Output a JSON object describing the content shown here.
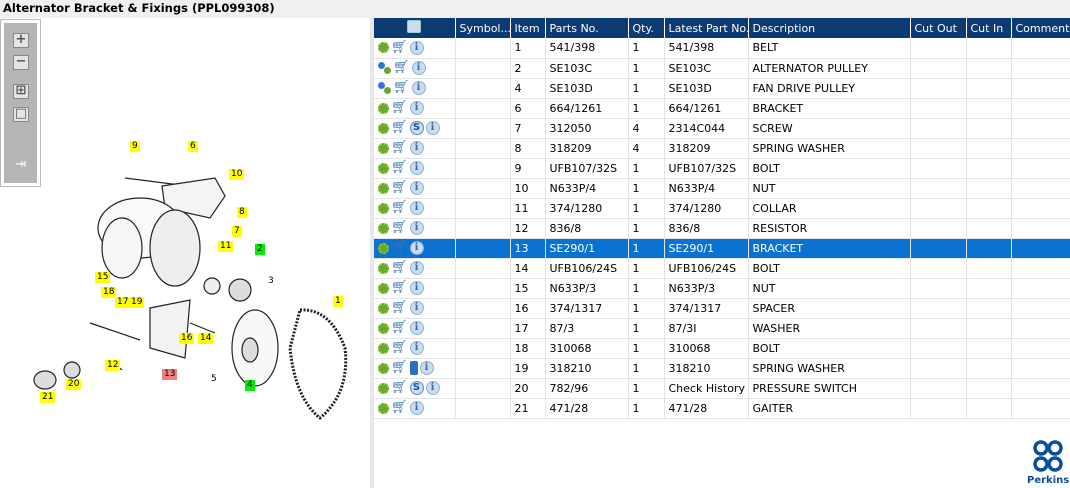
{
  "title": "Alternator Bracket & Fixings (PPL099308)",
  "toolbar": [
    "zoom-in",
    "zoom-out",
    "fit-all",
    "fit-window",
    "export"
  ],
  "callouts": [
    "9",
    "6",
    "10",
    "8",
    "7",
    "11",
    "2",
    "3",
    "15",
    "18",
    "17",
    "19",
    "1",
    "16",
    "14",
    "12",
    "13",
    "5",
    "4",
    "20",
    "21"
  ],
  "columns": [
    "",
    "Symbol...",
    "Item",
    "Parts No.",
    "Qty.",
    "Latest Part No.",
    "Description",
    "Cut Out",
    "Cut In",
    "Comment"
  ],
  "rows": [
    {
      "gear": "green",
      "extra": "",
      "item": "1",
      "part": "541/398",
      "qty": "1",
      "latest": "541/398",
      "desc": "BELT"
    },
    {
      "gear": "multi",
      "extra": "",
      "item": "2",
      "part": "SE103C",
      "qty": "1",
      "latest": "SE103C",
      "desc": "ALTERNATOR PULLEY"
    },
    {
      "gear": "multi",
      "extra": "",
      "item": "4",
      "part": "SE103D",
      "qty": "1",
      "latest": "SE103D",
      "desc": "FAN DRIVE PULLEY"
    },
    {
      "gear": "green",
      "extra": "",
      "item": "6",
      "part": "664/1261",
      "qty": "1",
      "latest": "664/1261",
      "desc": "BRACKET"
    },
    {
      "gear": "green",
      "extra": "S",
      "item": "7",
      "part": "312050",
      "qty": "4",
      "latest": "2314C044",
      "desc": "SCREW"
    },
    {
      "gear": "green",
      "extra": "",
      "item": "8",
      "part": "318209",
      "qty": "4",
      "latest": "318209",
      "desc": "SPRING WASHER"
    },
    {
      "gear": "green",
      "extra": "",
      "item": "9",
      "part": "UFB107/32S",
      "qty": "1",
      "latest": "UFB107/32S",
      "desc": "BOLT"
    },
    {
      "gear": "green",
      "extra": "",
      "item": "10",
      "part": "N633P/4",
      "qty": "1",
      "latest": "N633P/4",
      "desc": "NUT"
    },
    {
      "gear": "green",
      "extra": "",
      "item": "11",
      "part": "374/1280",
      "qty": "1",
      "latest": "374/1280",
      "desc": "COLLAR"
    },
    {
      "gear": "green",
      "extra": "",
      "item": "12",
      "part": "836/8",
      "qty": "1",
      "latest": "836/8",
      "desc": "RESISTOR"
    },
    {
      "gear": "green",
      "extra": "",
      "item": "13",
      "part": "SE290/1",
      "qty": "1",
      "latest": "SE290/1",
      "desc": "BRACKET",
      "selected": true
    },
    {
      "gear": "green",
      "extra": "",
      "item": "14",
      "part": "UFB106/24S",
      "qty": "1",
      "latest": "UFB106/24S",
      "desc": "BOLT"
    },
    {
      "gear": "green",
      "extra": "",
      "item": "15",
      "part": "N633P/3",
      "qty": "1",
      "latest": "N633P/3",
      "desc": "NUT"
    },
    {
      "gear": "green",
      "extra": "",
      "item": "16",
      "part": "374/1317",
      "qty": "1",
      "latest": "374/1317",
      "desc": "SPACER"
    },
    {
      "gear": "green",
      "extra": "",
      "item": "17",
      "part": "87/3",
      "qty": "1",
      "latest": "87/3I",
      "desc": "WASHER"
    },
    {
      "gear": "green",
      "extra": "",
      "item": "18",
      "part": "310068",
      "qty": "1",
      "latest": "310068",
      "desc": "BOLT"
    },
    {
      "gear": "green",
      "extra": "book",
      "item": "19",
      "part": "318210",
      "qty": "1",
      "latest": "318210",
      "desc": "SPRING WASHER"
    },
    {
      "gear": "green",
      "extra": "S",
      "item": "20",
      "part": "782/96",
      "qty": "1",
      "latest": "Check History",
      "desc": "PRESSURE SWITCH"
    },
    {
      "gear": "green",
      "extra": "",
      "item": "21",
      "part": "471/28",
      "qty": "1",
      "latest": "471/28",
      "desc": "GAITER"
    }
  ],
  "brand": "Perkins",
  "colors": {
    "header": "#0c3a73",
    "selected": "#0a72d1",
    "logo": "#0a4f9e"
  }
}
